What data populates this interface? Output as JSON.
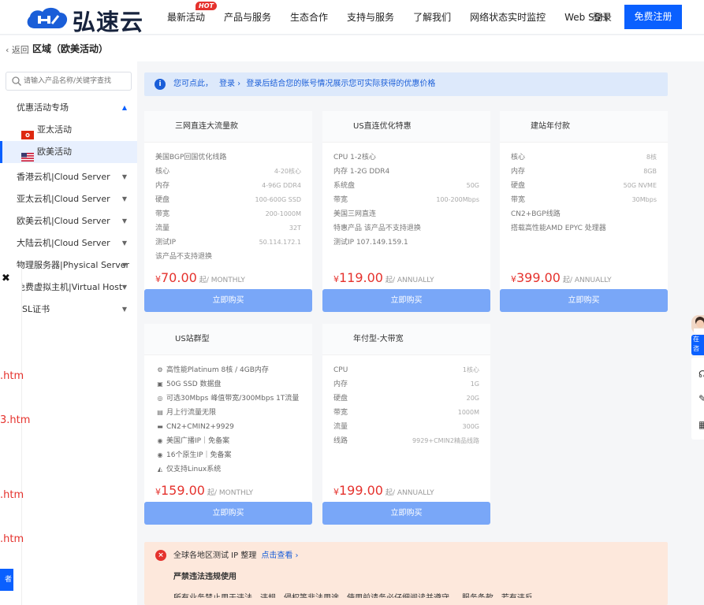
{
  "header": {
    "logo_text": "弘速云",
    "nav": [
      {
        "label": "最新活动",
        "badge": "HOT"
      },
      {
        "label": "产品与服务",
        "caret": true
      },
      {
        "label": "生态合作",
        "caret": true
      },
      {
        "label": "支持与服务",
        "caret": true
      },
      {
        "label": "了解我们",
        "caret": true
      },
      {
        "label": "网络状态实时监控"
      },
      {
        "label": "Web SSH"
      }
    ],
    "login": "登录",
    "register": "免费注册"
  },
  "breadcrumb": {
    "back": "返回",
    "title": "区域（欧美活动）"
  },
  "sidebar": {
    "search_placeholder": "请输入产品名称/关键字查找",
    "groups": [
      {
        "label": "优惠活动专场",
        "expanded": true,
        "children": [
          {
            "label": "亚太活动",
            "flag": "hk-flag-icon",
            "active": false
          },
          {
            "label": "欧美活动",
            "flag": "us-flag-icon",
            "active": true
          }
        ]
      },
      {
        "label": "香港云机|Cloud Server"
      },
      {
        "label": "亚太云机|Cloud Server"
      },
      {
        "label": "欧美云机|Cloud Server"
      },
      {
        "label": "大陆云机|Cloud Server"
      },
      {
        "label": "物理服务器|Physical Server"
      },
      {
        "label": "免费虚拟主机|Virtual Host"
      },
      {
        "label": "SSL证书"
      }
    ],
    "stray_links": [
      ".htm",
      "3.htm",
      ".htm",
      ".htm"
    ],
    "stray_button": "者"
  },
  "notice": {
    "prefix": "您可点此，",
    "login": "登录",
    "suffix": "登录后结合您的账号情况展示您可实际获得的优惠价格"
  },
  "cards": [
    {
      "title": "三网直连大流量款",
      "specs": [
        {
          "k": "美国BGP回国优化线路",
          "v": ""
        },
        {
          "k": "核心",
          "v": "4-20核心"
        },
        {
          "k": "内存",
          "v": "4-96G DDR4"
        },
        {
          "k": "硬盘",
          "v": "100-600G SSD"
        },
        {
          "k": "带宽",
          "v": "200-1000M"
        },
        {
          "k": "流量",
          "v": "32T"
        },
        {
          "k": "测试IP",
          "v": "50.114.172.1"
        },
        {
          "k": "该产品不支持退换",
          "v": ""
        }
      ],
      "currency": "¥",
      "price": "70.00",
      "unit": "起/ MONTHLY",
      "buy": "立即购买"
    },
    {
      "title": "US直连优化特惠",
      "specs": [
        {
          "k": "CPU 1-2核心",
          "v": ""
        },
        {
          "k": "内存 1-2G DDR4",
          "v": ""
        },
        {
          "k": "系统盘",
          "v": "50G"
        },
        {
          "k": "带宽",
          "v": "100-200Mbps"
        },
        {
          "k": "美国三网直连",
          "v": ""
        },
        {
          "k": "特惠产品 该产品不支持退换",
          "v": ""
        },
        {
          "k": "测试IP 107.149.159.1",
          "v": ""
        }
      ],
      "currency": "¥",
      "price": "119.00",
      "unit": "起/ ANNUALLY",
      "buy": "立即购买"
    },
    {
      "title": "建站年付款",
      "specs": [
        {
          "k": "核心",
          "v": "8核"
        },
        {
          "k": "内存",
          "v": "8GB"
        },
        {
          "k": "硬盘",
          "v": "50G NVME"
        },
        {
          "k": "带宽",
          "v": "30Mbps"
        },
        {
          "k": "CN2+BGP线路",
          "v": ""
        },
        {
          "k": "搭载高性能AMD EPYC 处理器",
          "v": ""
        }
      ],
      "currency": "¥",
      "price": "399.00",
      "unit": "起/ ANNUALLY",
      "buy": "立即购买"
    },
    {
      "title": "US站群型",
      "lines": [
        {
          "icon": "gear-icon",
          "glyph": "⚙",
          "text": "高性能Platinum 8核 / 4GB内存"
        },
        {
          "icon": "disk-icon",
          "glyph": "▣",
          "text": "50G SSD 数据盘"
        },
        {
          "icon": "globe-icon",
          "glyph": "◎",
          "text": "可选30Mbps 峰值带宽/300Mbps 1T流量"
        },
        {
          "icon": "chart-icon",
          "glyph": "▤",
          "text": "月上行流量无限"
        },
        {
          "icon": "network-icon",
          "glyph": "▬",
          "text": "CN2+CMIN2+9929"
        },
        {
          "icon": "earth-icon",
          "glyph": "◉",
          "text": "美国广播IP｜免备案"
        },
        {
          "icon": "earth-icon",
          "glyph": "◉",
          "text": "16个原生IP｜免备案"
        },
        {
          "icon": "linux-icon",
          "glyph": "◭",
          "text": "仅支持Linux系统"
        }
      ],
      "currency": "¥",
      "price": "159.00",
      "unit": "起/ MONTHLY",
      "buy": "立即购买"
    },
    {
      "title": "年付型-大带宽",
      "specs": [
        {
          "k": "CPU",
          "v": "1核心"
        },
        {
          "k": "内存",
          "v": "1G"
        },
        {
          "k": "硬盘",
          "v": "20G"
        },
        {
          "k": "带宽",
          "v": "1000M"
        },
        {
          "k": "流量",
          "v": "300G"
        },
        {
          "k": "线路",
          "v": "9929+CMIN2精品线路"
        }
      ],
      "currency": "¥",
      "price": "199.00",
      "unit": "起/ ANNUALLY",
      "buy": "立即购买"
    }
  ],
  "warning": {
    "text": "全球各地区测试 IP 整理",
    "link": "点击查看 ›",
    "title": "严禁违法违规使用",
    "cut_line": "所有业务禁止用于违法、违规、侵权等非法用途，使用前请务必仔细阅读并遵守 ... 服务条款，若有违反"
  },
  "float_right": {
    "consult": "在咨"
  },
  "colors": {
    "brand": "#0a60ff",
    "price": "#e5322d",
    "buy_button": "#79a7f8",
    "notice_bg": "#dde9fb",
    "warn_bg": "#fde8dc"
  }
}
